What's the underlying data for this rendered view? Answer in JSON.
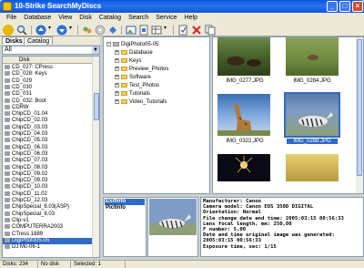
{
  "window": {
    "title": "10-Strike SearchMyDiscs"
  },
  "title_buttons": {
    "minimize": "_",
    "maximize": "□",
    "close": "×"
  },
  "menu": [
    "File",
    "Database",
    "View",
    "Disk",
    "Catalog",
    "Search",
    "Service",
    "Help"
  ],
  "toolbar_icons": [
    "open-icon",
    "search-icon",
    "nav-up-icon",
    "nav-down-icon",
    "settings-icon",
    "disk-scan-icon",
    "move-icon",
    "image-icon",
    "export-icon",
    "view-mode-icon",
    "properties-icon",
    "delete-icon",
    "copy-icon"
  ],
  "left_tabs": [
    "Disks",
    "Catalog"
  ],
  "filter": {
    "value": "All"
  },
  "disk_column_header": "Disk",
  "disks": [
    "CD_027: CPress",
    "CD_028: Keys",
    "CD_029",
    "CD_030",
    "CD_031",
    "CD_032: Boot",
    "CDRW",
    "ChipCD_01.04",
    "ChipCD_02.03",
    "ChipCD_03.03",
    "ChipCD_04.03",
    "ChipCD_05.03",
    "ChipCD_06.03",
    "ChipCD_06.03",
    "ChipCD_07.03",
    "ChipCD_08.03",
    "ChipCD_09.02",
    "ChipCD_09.03",
    "ChipCD_10.03",
    "ChipCD_11.02",
    "ChipCD_12.03",
    "ChipSpecial_6.03(ASP)",
    "ChipSpecial_8.03",
    "Clip-v1",
    "COMPUTERRA2003",
    "CTress 1889",
    "DigiPhoto05-05",
    "DJ Mc-06-1"
  ],
  "selected_disk_index": 26,
  "tree": {
    "root": "DigiPhoto05-05",
    "folders": [
      "Database",
      "Keys",
      "Preview_Photos",
      "Software",
      "Test_Photos",
      "Tutorials",
      "Video_Tutorials"
    ]
  },
  "thumbnails": [
    {
      "caption": "IMG_0277.JPG",
      "selected": false
    },
    {
      "caption": "IMG_0284.JPG",
      "selected": false
    },
    {
      "caption": "IMG_0322.JPG",
      "selected": false
    },
    {
      "caption": "IMG_0288.JPG",
      "selected": true
    }
  ],
  "info_items": [
    "ExifInfo",
    "PictInfo"
  ],
  "exif_lines": [
    "Manufacturer: Canon",
    "Camera model: Canon EOS 350D DIGITAL",
    "Orientation: Normal",
    "File change date and time: 2005:03:15 00:56:33",
    "Lens focal length, mm: 250,00",
    "F number: 5,00",
    "Date and time original image was generated:",
    "2005:03:15 00:56:33",
    "Exposure time, sec: 1/15"
  ],
  "status": [
    "Disks: 234",
    "No disk",
    "Selected: 1"
  ],
  "colors": {
    "accent": "#316ac5",
    "titlebar": "#0a58e0",
    "chrome": "#ece9d8"
  }
}
